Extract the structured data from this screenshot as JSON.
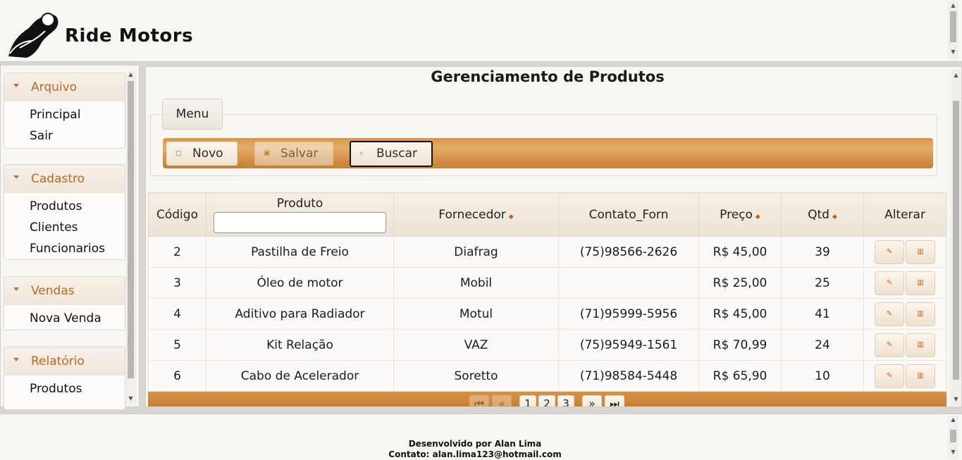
{
  "header": {
    "brand": "Ride Motors",
    "logo_icon": "motorcycle-rider-icon"
  },
  "sidebar": {
    "panels": [
      {
        "title": "Arquivo",
        "items": [
          "Principal",
          "Sair"
        ]
      },
      {
        "title": "Cadastro",
        "items": [
          "Produtos",
          "Clientes",
          "Funcionarios"
        ]
      },
      {
        "title": "Vendas",
        "items": [
          "Nova Venda"
        ]
      },
      {
        "title": "Relatório",
        "items": [
          "Produtos"
        ]
      }
    ]
  },
  "main": {
    "title": "Gerenciamento de Produtos",
    "menu_legend": "Menu",
    "toolbar": {
      "novo": "Novo",
      "salvar": "Salvar",
      "buscar": "Buscar"
    },
    "table": {
      "columns": [
        "Código",
        "Produto",
        "Fornecedor",
        "Contato_Forn",
        "Preço",
        "Qtd",
        "Alterar"
      ],
      "filter_value": "",
      "rows": [
        [
          "2",
          "Pastilha de Freio",
          "Diafrag",
          "(75)98566-2626",
          "R$ 45,00",
          "39"
        ],
        [
          "3",
          "Óleo de motor",
          "Mobil",
          "",
          "R$ 25,00",
          "25"
        ],
        [
          "4",
          "Aditivo para Radiador",
          "Motul",
          "(71)95999-5956",
          "R$ 45,00",
          "41"
        ],
        [
          "5",
          "Kit Relação",
          "VAZ",
          "(75)95949-1561",
          "R$ 70,99",
          "24"
        ],
        [
          "6",
          "Cabo de Acelerador",
          "Soretto",
          "(71)98584-5448",
          "R$ 65,90",
          "10"
        ]
      ]
    },
    "paginator": {
      "pages": [
        "1",
        "2",
        "3"
      ]
    }
  },
  "footer": {
    "line1": "Desenvolvido por Alan Lima",
    "line2": "Contato: alan.lima123@hotmail.com"
  },
  "colors": {
    "accent": "#c2651b",
    "toolbar": "#d08a3e",
    "background": "#f8f6f3"
  }
}
